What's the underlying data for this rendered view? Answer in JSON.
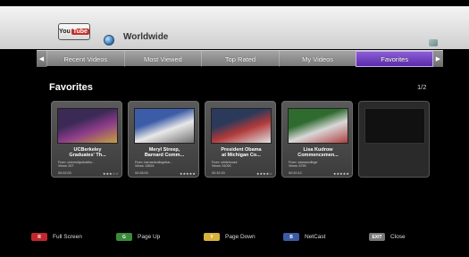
{
  "header": {
    "logo_you": "You",
    "logo_tube": "Tube",
    "region": "Worldwide"
  },
  "tabs": [
    {
      "label": "Recent Videos",
      "active": false
    },
    {
      "label": "Most Viewed",
      "active": false
    },
    {
      "label": "Top Rated",
      "active": false
    },
    {
      "label": "My Videos",
      "active": false
    },
    {
      "label": "Favorites",
      "active": true
    }
  ],
  "main": {
    "title": "Favorites",
    "page": "1/2",
    "videos": [
      {
        "title_line1": "UCBerkeley",
        "title_line2": "Graduates' Th...",
        "from": "From: universityofcalifor...",
        "views": "Views: 527",
        "duration": "00:02:00",
        "rating": "★★★☆☆",
        "thumb_colors": [
          "#3a2a55",
          "#8a3a8a",
          "#c8a040"
        ]
      },
      {
        "title_line1": "Meryl Streep,",
        "title_line2": "Barnard Comm...",
        "from": "From: barnardcollegebar...",
        "views": "Views: 18524",
        "duration": "00:28:00",
        "rating": "★★★★★",
        "thumb_colors": [
          "#3d5ca8",
          "#e8e8e8",
          "#707070"
        ]
      },
      {
        "title_line1": "President Obama",
        "title_line2": "at Michigan Co...",
        "from": "From: whitehouse",
        "views": "Views: 51093",
        "duration": "00:32:20",
        "rating": "★★★★☆",
        "thumb_colors": [
          "#2b3a5a",
          "#b23a3a",
          "#e0e0e0"
        ]
      },
      {
        "title_line1": "Lisa Kudrow",
        "title_line2": "Commencemen...",
        "from": "From: vassarcollege",
        "views": "Views: 5799",
        "duration": "00:20:12",
        "rating": "★★★★★",
        "thumb_colors": [
          "#2f6a2f",
          "#d8d8d8",
          "#b04040"
        ]
      }
    ]
  },
  "footer": [
    {
      "key": "R",
      "label": "Full Screen",
      "color": "#c0272d"
    },
    {
      "key": "G",
      "label": "Page Up",
      "color": "#3a8a3a"
    },
    {
      "key": "Y",
      "label": "Page Down",
      "color": "#d6b23a"
    },
    {
      "key": "B",
      "label": "NetCast",
      "color": "#3b5aa6"
    },
    {
      "key": "EXIT",
      "label": "Close",
      "color": "#777777"
    }
  ]
}
